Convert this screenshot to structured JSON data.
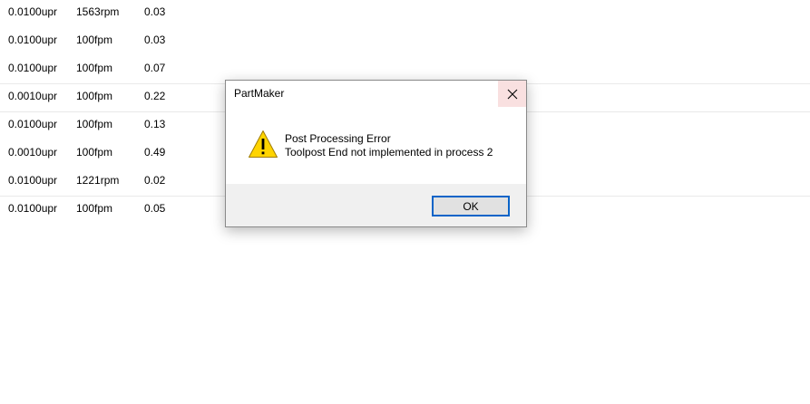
{
  "table": {
    "rows": [
      {
        "feed": "0.0100upr",
        "speed": "1563rpm",
        "time": "0.03"
      },
      {
        "feed": "0.0100upr",
        "speed": "100fpm",
        "time": "0.03"
      },
      {
        "feed": "0.0100upr",
        "speed": "100fpm",
        "time": "0.07"
      },
      {
        "feed": "0.0010upr",
        "speed": "100fpm",
        "time": "0.22"
      },
      {
        "feed": "0.0100upr",
        "speed": "100fpm",
        "time": "0.13"
      },
      {
        "feed": "0.0010upr",
        "speed": "100fpm",
        "time": "0.49"
      },
      {
        "feed": "0.0100upr",
        "speed": "1221rpm",
        "time": "0.02"
      },
      {
        "feed": "0.0100upr",
        "speed": "100fpm",
        "time": "0.05"
      }
    ]
  },
  "dialog": {
    "title": "PartMaker",
    "close_icon": "close-icon",
    "icon": "warning-icon",
    "message_line1": "Post Processing Error",
    "message_line2": "Toolpost End not implemented in process 2",
    "ok_label": "OK"
  },
  "colors": {
    "close_hover": "#f9e0e0",
    "footer_bg": "#f0f0f0",
    "ok_border": "#0a64c8",
    "warning_fill": "#ffd400"
  }
}
